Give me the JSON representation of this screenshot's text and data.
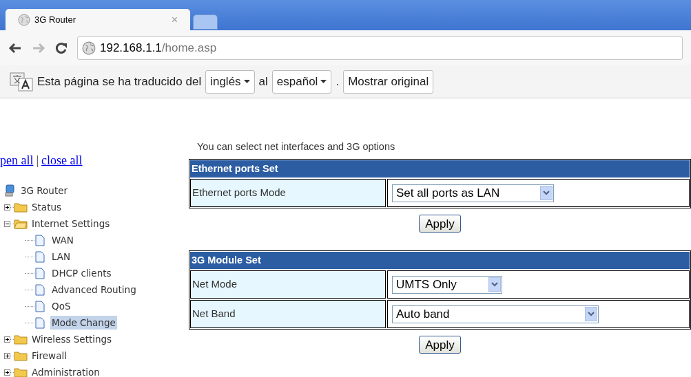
{
  "browser": {
    "tab": {
      "title": "3G Router",
      "close": "×"
    },
    "address": {
      "host": "192.168.1.1",
      "path": "/home.asp"
    },
    "translate_bar": {
      "message": "Esta página se ha traducido del",
      "from_language": "inglés",
      "connector": "al",
      "to_language": "español",
      "separator": ".",
      "show_original": "Mostrar original"
    }
  },
  "sidebar": {
    "links": [
      {
        "label": "pen all"
      },
      {
        "label": "close all"
      }
    ],
    "link_separator": "|",
    "tree": {
      "label": "3G Router",
      "children": [
        {
          "kind": "folder",
          "label": "Status",
          "expanded": false
        },
        {
          "kind": "folder",
          "label": "Internet Settings",
          "expanded": true,
          "children": [
            {
              "kind": "page",
              "label": "WAN",
              "selected": false
            },
            {
              "kind": "page",
              "label": "LAN",
              "selected": false
            },
            {
              "kind": "page",
              "label": "DHCP clients",
              "selected": false
            },
            {
              "kind": "page",
              "label": "Advanced Routing",
              "selected": false
            },
            {
              "kind": "page",
              "label": "QoS",
              "selected": false
            },
            {
              "kind": "page",
              "label": "Mode Change",
              "selected": true
            }
          ]
        },
        {
          "kind": "folder",
          "label": "Wireless Settings",
          "expanded": false
        },
        {
          "kind": "folder",
          "label": "Firewall",
          "expanded": false
        },
        {
          "kind": "folder",
          "label": "Administration",
          "expanded": false
        }
      ]
    }
  },
  "main": {
    "intro": "You can select net interfaces and 3G options",
    "sections": [
      {
        "title": "Ethernet ports Set",
        "rows": [
          {
            "label": "Ethernet ports Mode",
            "value": "Set all ports as LAN"
          }
        ],
        "button": "Apply"
      },
      {
        "title": "3G Module Set",
        "rows": [
          {
            "label": "Net Mode",
            "value": "UMTS Only"
          },
          {
            "label": "Net Band",
            "value": "Auto band"
          }
        ],
        "button": "Apply"
      }
    ]
  }
}
